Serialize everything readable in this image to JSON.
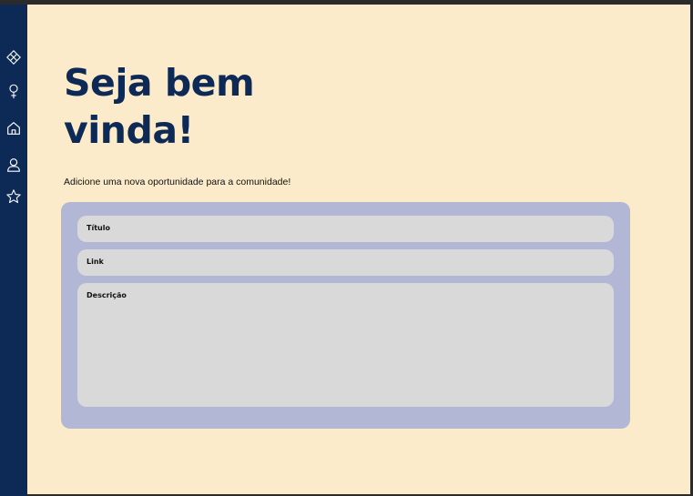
{
  "colors": {
    "sidebar": "#0d2a57",
    "background": "#fcebcb",
    "heading": "#0d2a57",
    "form_card": "#b3b7d6",
    "field": "#d9d9d9"
  },
  "sidebar": {
    "items": [
      {
        "icon": "diamond-grid-icon"
      },
      {
        "icon": "female-symbol-icon"
      },
      {
        "icon": "home-icon"
      },
      {
        "icon": "user-icon"
      },
      {
        "icon": "star-icon"
      }
    ]
  },
  "main": {
    "heading_line1": "Seja bem",
    "heading_line2": "vinda!",
    "subtitle": "Adicione uma nova oportunidade para a comunidade!"
  },
  "form": {
    "title_placeholder": "Título",
    "link_placeholder": "Link",
    "description_placeholder": "Descrição"
  }
}
